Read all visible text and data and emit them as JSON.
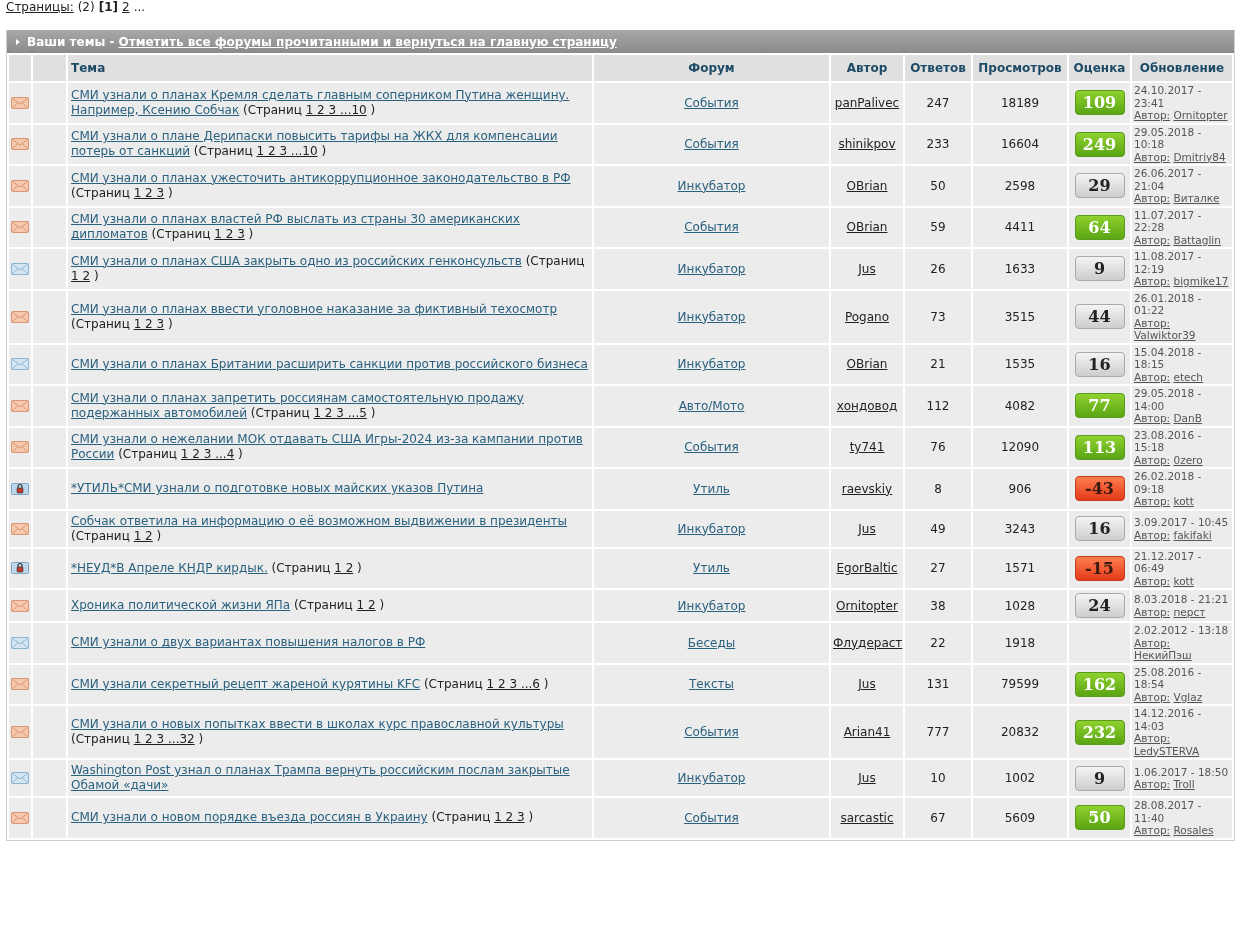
{
  "pagination": {
    "label": "Страницы:",
    "count": "(2)",
    "current": "[1]",
    "next": "2",
    "more": "..."
  },
  "panel": {
    "title": "Ваши темы -",
    "action": "Отметить все форумы прочитанными и вернуться на главную страницу"
  },
  "columns": [
    "Тема",
    "Форум",
    "Автор",
    "Ответов",
    "Просмотров",
    "Оценка",
    "Обновление"
  ],
  "rows": [
    {
      "kind": "new",
      "topic": "СМИ узнали о планах Кремля сделать главным соперником Путина женщину. Например, Ксению Собчак",
      "pages": {
        "label": "(Страниц",
        "links": "1 2 3 ...10",
        "close": ")"
      },
      "forum": "События",
      "author": "panPalivec",
      "replies": "247",
      "views": "18189",
      "rating": {
        "text": "109",
        "kind": "positive"
      },
      "date": "24.10.2017 - 23:41",
      "by": "Автор:",
      "last": "Ornitopter"
    },
    {
      "kind": "new",
      "topic": "СМИ узнали о плане Дерипаски повысить тарифы на ЖКХ для компенсации потерь от санкций",
      "pages": {
        "label": "(Страниц",
        "links": "1 2 3 ...10",
        "close": ")"
      },
      "forum": "События",
      "author": "shinikpov",
      "replies": "233",
      "views": "16604",
      "rating": {
        "text": "249",
        "kind": "positive"
      },
      "date": "29.05.2018 - 10:18",
      "by": "Автор:",
      "last": "Dmitriy84"
    },
    {
      "kind": "new",
      "topic": "СМИ узнали о планах ужесточить антикоррупционное законодательство в РФ",
      "pages": {
        "label": "(Страниц",
        "links": "1 2 3",
        "close": ")"
      },
      "forum": "Инкубатор",
      "author": "OBrian",
      "replies": "50",
      "views": "2598",
      "rating": {
        "text": "29",
        "kind": "neutral"
      },
      "date": "26.06.2017 - 21:04",
      "by": "Автор:",
      "last": "Виталке"
    },
    {
      "kind": "new",
      "topic": "СМИ узнали о планах властей РФ выслать из страны 30 американских дипломатов",
      "pages": {
        "label": "(Страниц",
        "links": "1 2 3",
        "close": ")"
      },
      "forum": "События",
      "author": "OBrian",
      "replies": "59",
      "views": "4411",
      "rating": {
        "text": "64",
        "kind": "positive"
      },
      "date": "11.07.2017 - 22:28",
      "by": "Автор:",
      "last": "Battaglin"
    },
    {
      "kind": "read",
      "topic": "СМИ узнали о планах США закрыть одно из российских генконсульств",
      "pages": {
        "label": "(Страниц",
        "links": "1 2",
        "close": ")"
      },
      "forum": "Инкубатор",
      "author": "Jus",
      "replies": "26",
      "views": "1633",
      "rating": {
        "text": "9",
        "kind": "neutral"
      },
      "date": "11.08.2017 - 12:19",
      "by": "Автор:",
      "last": "bigmike17"
    },
    {
      "kind": "new",
      "topic": "СМИ узнали о планах ввести уголовное наказание за фиктивный техосмотр",
      "pages": {
        "label": "(Страниц",
        "links": "1 2 3",
        "close": ")"
      },
      "forum": "Инкубатор",
      "author": "Pogano",
      "replies": "73",
      "views": "3515",
      "rating": {
        "text": "44",
        "kind": "neutral"
      },
      "date": "26.01.2018 - 01:22",
      "by": "Автор:",
      "last": "Valwiktor39"
    },
    {
      "kind": "read",
      "topic": "СМИ узнали о планах Британии расширить санкции против российского бизнеса",
      "forum": "Инкубатор",
      "author": "OBrian",
      "replies": "21",
      "views": "1535",
      "rating": {
        "text": "16",
        "kind": "neutral"
      },
      "date": "15.04.2018 - 18:15",
      "by": "Автор:",
      "last": "etech"
    },
    {
      "kind": "new",
      "topic": "СМИ узнали о планах запретить россиянам самостоятельную продажу подержанных автомобилей",
      "pages": {
        "label": "(Страниц",
        "links": "1 2 3 ...5",
        "close": ")"
      },
      "forum": "Авто/Мото",
      "author": "хондовод",
      "replies": "112",
      "views": "4082",
      "rating": {
        "text": "77",
        "kind": "positive"
      },
      "date": "29.05.2018 - 14:00",
      "by": "Автор:",
      "last": "DanB"
    },
    {
      "kind": "new",
      "topic": "СМИ узнали о нежелании МОК отдавать США Игры-2024 из-за кампании против России",
      "pages": {
        "label": "(Страниц",
        "links": "1 2 3 ...4",
        "close": ")"
      },
      "forum": "События",
      "author": "ty741",
      "replies": "76",
      "views": "12090",
      "rating": {
        "text": "113",
        "kind": "positive"
      },
      "date": "23.08.2016 - 15:18",
      "by": "Автор:",
      "last": "0zero"
    },
    {
      "kind": "closed",
      "topic": "*УТИЛЬ*СМИ узнали о подготовке новых майских указов Путина",
      "forum": "Утиль",
      "author": "raevskiy",
      "replies": "8",
      "views": "906",
      "rating": {
        "text": "-43",
        "kind": "negative"
      },
      "date": "26.02.2018 - 09:18",
      "by": "Автор:",
      "last": "kott"
    },
    {
      "kind": "new",
      "topic": "Собчак ответила на информацию о её возможном выдвижении в президенты",
      "pages": {
        "label": "(Страниц",
        "links": "1 2",
        "close": ")"
      },
      "forum": "Инкубатор",
      "author": "Jus",
      "replies": "49",
      "views": "3243",
      "rating": {
        "text": "16",
        "kind": "neutral"
      },
      "date": "3.09.2017 - 10:45",
      "by": "Автор:",
      "last": "fakifaki"
    },
    {
      "kind": "closed",
      "topic": "*НЕУД*В Апреле КНДР кирдык.",
      "pages": {
        "label": "(Страниц",
        "links": "1 2",
        "close": ")"
      },
      "forum": "Утиль",
      "author": "EgorBaltic",
      "replies": "27",
      "views": "1571",
      "rating": {
        "text": "-15",
        "kind": "negative"
      },
      "date": "21.12.2017 - 06:49",
      "by": "Автор:",
      "last": "kott"
    },
    {
      "kind": "new",
      "topic": "Хроника политической жизни ЯПа",
      "pages": {
        "label": "(Страниц",
        "links": "1 2",
        "close": ")"
      },
      "forum": "Инкубатор",
      "author": "Ornitopter",
      "replies": "38",
      "views": "1028",
      "rating": {
        "text": "24",
        "kind": "neutral"
      },
      "date": "8.03.2018 - 21:21",
      "by": "Автор:",
      "last": "перст"
    },
    {
      "kind": "read",
      "topic": "СМИ узнали о двух вариантах повышения налогов в РФ",
      "forum": "Беседы",
      "author": "Флудераст",
      "replies": "22",
      "views": "1918",
      "date": "2.02.2012 - 13:18",
      "by": "Автор:",
      "last": "НекийПэш"
    },
    {
      "kind": "new",
      "topic": "СМИ узнали секретный рецепт жареной курятины KFC",
      "pages": {
        "label": "(Страниц",
        "links": "1 2 3 ...6",
        "close": ")"
      },
      "forum": "Тексты",
      "author": "Jus",
      "replies": "131",
      "views": "79599",
      "rating": {
        "text": "162",
        "kind": "positive"
      },
      "date": "25.08.2016 - 18:54",
      "by": "Автор:",
      "last": "Vglaz"
    },
    {
      "kind": "new",
      "topic": "СМИ узнали о новых попытках ввести в школах курс православной культуры",
      "pages": {
        "label": "(Страниц",
        "links": "1 2 3 ...32",
        "close": ")"
      },
      "forum": "События",
      "author": "Arian41",
      "replies": "777",
      "views": "20832",
      "rating": {
        "text": "232",
        "kind": "positive"
      },
      "date": "14.12.2016 - 14:03",
      "by": "Автор:",
      "last": "LedySTERVA"
    },
    {
      "kind": "read",
      "topic": "Washington Post узнал о планах Трампа вернуть российским послам закрытые Обамой «дачи»",
      "forum": "Инкубатор",
      "author": "Jus",
      "replies": "10",
      "views": "1002",
      "rating": {
        "text": "9",
        "kind": "neutral"
      },
      "date": "1.06.2017 - 18:50",
      "by": "Автор:",
      "last": "Troll"
    },
    {
      "kind": "new",
      "topic": "СМИ узнали о новом порядке въезда россиян в Украину",
      "pages": {
        "label": "(Страниц",
        "links": "1 2 3",
        "close": ")"
      },
      "forum": "События",
      "author": "sarcastic",
      "replies": "67",
      "views": "5609",
      "rating": {
        "text": "50",
        "kind": "positive"
      },
      "date": "28.08.2017 - 11:40",
      "by": "Автор:",
      "last": "Rosales"
    }
  ]
}
